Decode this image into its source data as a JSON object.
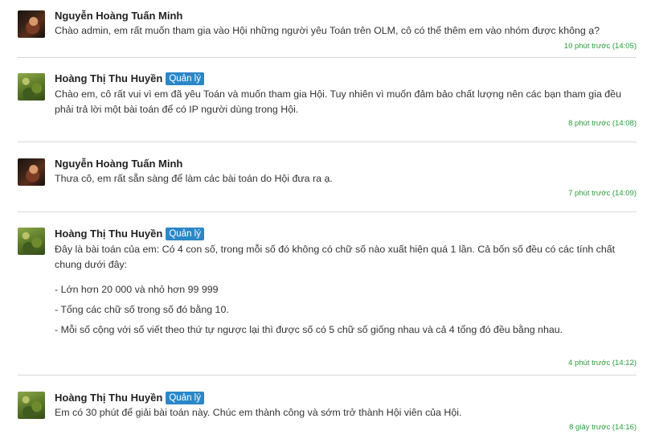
{
  "messages": [
    {
      "author": "Nguyễn Hoàng Tuấn Minh",
      "text": "Chào admin, em rất muốn tham gia vào Hội những người yêu Toán trên OLM, cô có thể thêm em vào nhóm được không ạ?",
      "time": "10 phút trước (14:05)"
    },
    {
      "author": "Hoàng Thị Thu Huyền",
      "badge": "Quản lý",
      "text": "Chào em, cô rất vui vì em đã yêu Toán và muốn tham gia Hội. Tuy nhiên vì muốn đảm bảo chất lượng nên các bạn tham gia đều phải trả lời một bài toán để có IP người dùng trong Hội.",
      "time": "8 phút trước (14:08)"
    },
    {
      "author": "Nguyễn Hoàng Tuấn Minh",
      "text": "Thưa cô, em rất sẵn sàng để làm các bài toán do Hội đưa ra ạ.",
      "time": "7 phút trước (14:09)"
    },
    {
      "author": "Hoàng Thị Thu Huyền",
      "badge": "Quản lý",
      "text": "Đây là bài toán của em: Có 4 con số, trong mỗi số đó không có chữ số nào xuất hiện quá 1 lần. Cả bốn số đều có các tính chất chung dưới đây:",
      "bullets": [
        "- Lớn hơn 20 000 và nhỏ hơn 99 999",
        "- Tổng các chữ số trong số đó bằng 10.",
        "- Mỗi số cộng với số viết theo thứ tự ngược lại thì được số có 5 chữ số giống nhau và cả 4 tổng đó đều bằng nhau."
      ],
      "time": "4 phút trước (14:12)"
    },
    {
      "author": "Hoàng Thị Thu Huyền",
      "badge": "Quản lý",
      "text": "Em có 30 phút để giải bài toán này. Chúc em thành công và sớm trở thành Hội viên của Hội.",
      "time": "8 giây trước (14:16)"
    }
  ],
  "colors": {
    "badge": "#2b87c7",
    "timestamp": "#2a9c3a",
    "divider": "#d8d8d8"
  }
}
